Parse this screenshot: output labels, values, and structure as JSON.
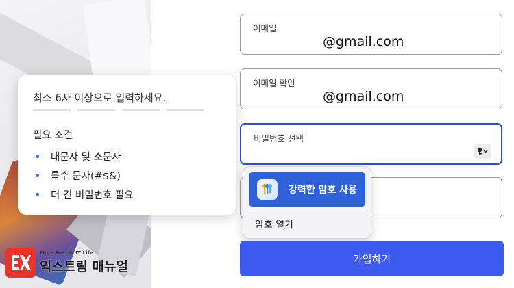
{
  "tooltip": {
    "heading": "최소 6자 이상으로 입력하세요.",
    "requirements_title": "필요 조건",
    "requirements": [
      "대문자 및 소문자",
      "특수 문자(#$&)",
      "더 긴 비밀번호 필요"
    ]
  },
  "form": {
    "email_label": "이메일",
    "email_value": "@gmail.com",
    "email_confirm_label": "이메일 확인",
    "email_confirm_value": "@gmail.com",
    "password_label": "비밀번호 선택",
    "password_value": "",
    "extra_value": "",
    "signup_label": "가입하기"
  },
  "autofill": {
    "strong_password_label": "강력한 암호 사용",
    "open_passwords_label": "암호 열기"
  },
  "watermark": {
    "tagline": "More Better IT Life",
    "name": "익스트림 매뉴얼"
  },
  "colors": {
    "accent": "#2d4fd6",
    "signup_button": "#3b5bf0",
    "strong_password_button": "#2f62d9",
    "bullet": "#3a6ee8",
    "logo_red": "#e8352a"
  }
}
